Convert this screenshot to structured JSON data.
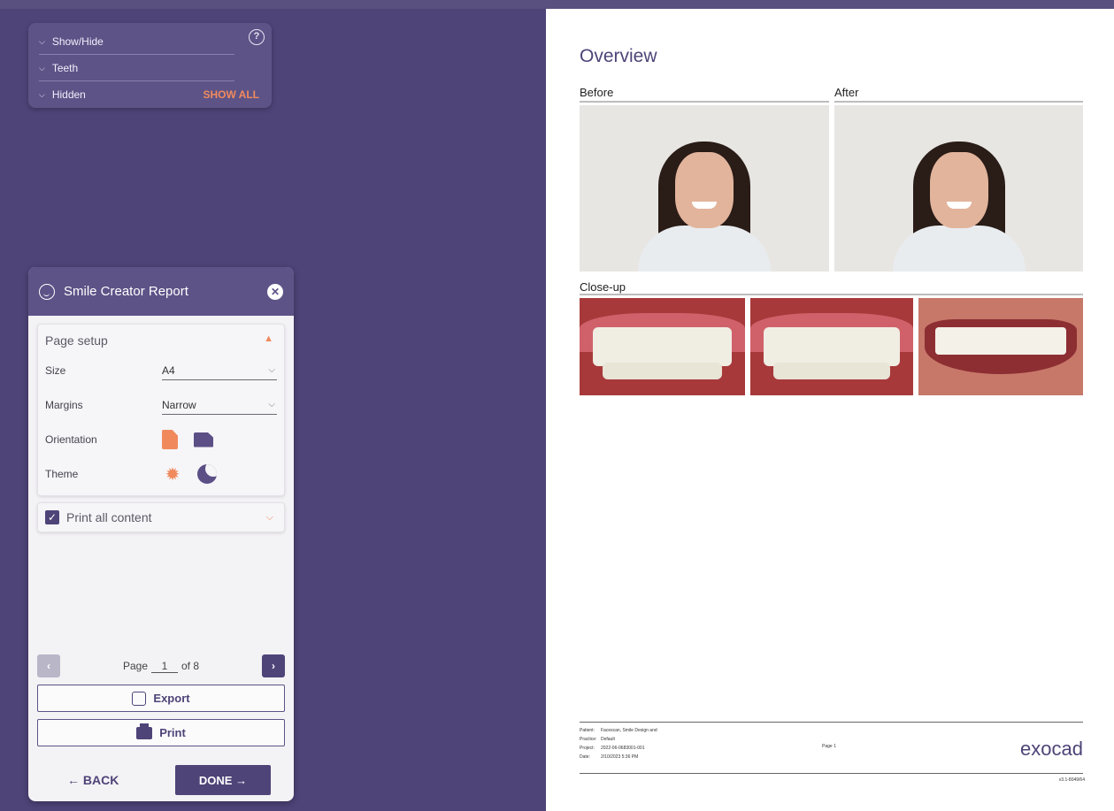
{
  "show_hide_panel": {
    "rows": [
      {
        "label": "Show/Hide"
      },
      {
        "label": "Teeth"
      },
      {
        "label": "Hidden",
        "action": "SHOW ALL"
      }
    ],
    "help_glyph": "?"
  },
  "report_panel": {
    "title": "Smile Creator Report",
    "page_setup": {
      "title": "Page setup",
      "size_label": "Size",
      "size_value": "A4",
      "margins_label": "Margins",
      "margins_value": "Narrow",
      "orientation_label": "Orientation",
      "theme_label": "Theme"
    },
    "print_all": {
      "label": "Print all content",
      "checked": true
    },
    "pager": {
      "page_label": "Page",
      "current": "1",
      "of_label": "of 8"
    },
    "export_label": "Export",
    "print_label": "Print",
    "back_label": "← BACK",
    "done_label": "DONE →"
  },
  "document": {
    "title": "Overview",
    "before_label": "Before",
    "after_label": "After",
    "closeup_label": "Close-up",
    "footer": {
      "rows": [
        {
          "k": "Patient:",
          "v": "Facescan, Smile Design and"
        },
        {
          "k": "Practice:",
          "v": "Default"
        },
        {
          "k": "Project:",
          "v": "2022-06-0683001-001"
        },
        {
          "k": "Date:",
          "v": "2/10/2023 5:36 PM"
        }
      ],
      "page": "Page 1",
      "brand": "exocad",
      "version": "v3.1-8049/64"
    }
  },
  "colors": {
    "background": "#4e4478",
    "panel_header": "#5d5387",
    "accent": "#f08a5d",
    "page": "#ffffff"
  },
  "icons": [
    "chevron-down-icon",
    "help-circle-icon",
    "smile-face-icon",
    "close-circle-icon",
    "portrait-icon",
    "landscape-icon",
    "sun-icon",
    "moon-icon",
    "checkbox-icon",
    "export-icon",
    "printer-icon"
  ]
}
